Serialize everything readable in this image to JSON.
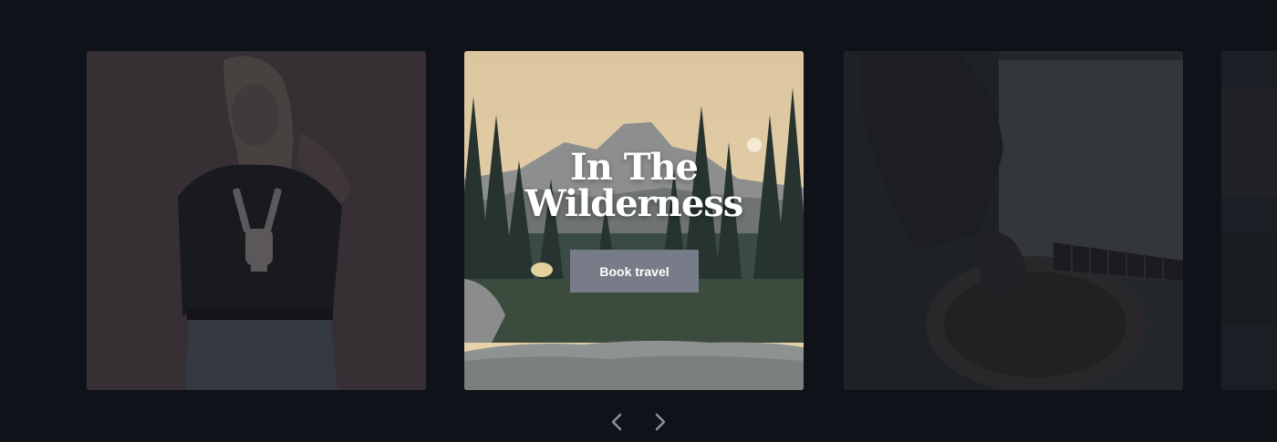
{
  "carousel": {
    "slides": [
      {
        "image": "woman-in-skeleton-tshirt-photo",
        "active": false
      },
      {
        "image": "mountain-forest-landscape-photo",
        "active": true,
        "title_line1": "In The",
        "title_line2": "Wilderness",
        "button_label": "Book travel"
      },
      {
        "image": "guitar-player-photo",
        "active": false
      },
      {
        "image": "partial-next-slide-photo",
        "active": false
      }
    ],
    "nav": {
      "prev_icon": "chevron-left-icon",
      "next_icon": "chevron-right-icon"
    }
  },
  "colors": {
    "background": "#10121a",
    "button": "#777c88",
    "title": "#ffffff",
    "nav_arrow": "#8a8f99"
  }
}
